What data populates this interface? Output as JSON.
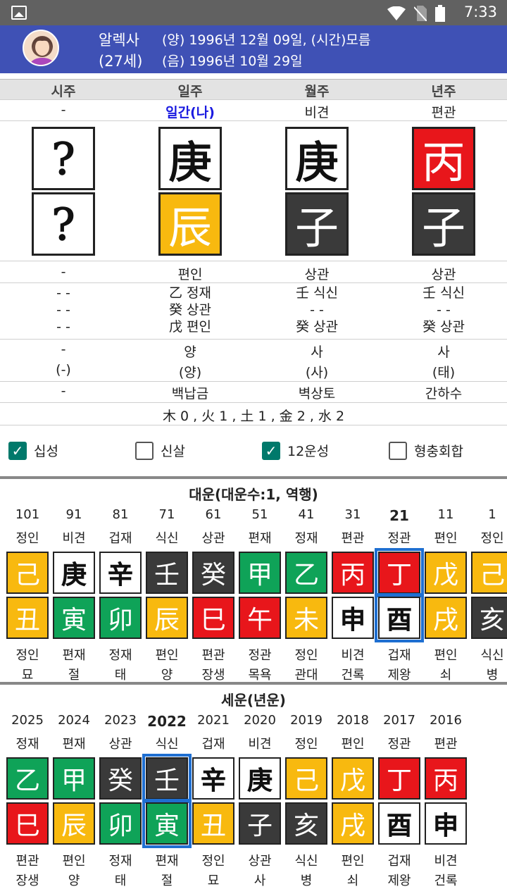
{
  "status": {
    "time": "7:33"
  },
  "profile": {
    "name": "알렉사",
    "age": "(27세)",
    "solar": "(양) 1996년 12월 09일, (시간)모름",
    "lunar": "(음) 1996년 10월 29일"
  },
  "pillars": {
    "headers": [
      "시주",
      "일주",
      "월주",
      "년주"
    ],
    "roles": [
      "-",
      "일간(나)",
      "비견",
      "편관"
    ],
    "stems": [
      {
        "char": "?",
        "color": "white"
      },
      {
        "char": "庚",
        "color": "white"
      },
      {
        "char": "庚",
        "color": "white"
      },
      {
        "char": "丙",
        "color": "red"
      }
    ],
    "branches": [
      {
        "char": "?",
        "color": "white"
      },
      {
        "char": "辰",
        "color": "yellow"
      },
      {
        "char": "子",
        "color": "dark"
      },
      {
        "char": "子",
        "color": "dark"
      }
    ],
    "branch_roles": [
      "-",
      "편인",
      "상관",
      "상관"
    ],
    "hidden": [
      [
        "- -",
        "- -",
        "- -"
      ],
      [
        "乙 정재",
        "癸 상관",
        "戊 편인"
      ],
      [
        "壬 식신",
        "- -",
        "癸 상관"
      ],
      [
        "壬 식신",
        "- -",
        "癸 상관"
      ]
    ],
    "stage": [
      "-",
      "양",
      "사",
      "사"
    ],
    "stage2": [
      "(-)",
      "(양)",
      "(사)",
      "(태)"
    ],
    "napeum": [
      "-",
      "백납금",
      "벽상토",
      "간하수"
    ],
    "elements": "木 0 , 火 1 , 土 1 , 金 2 , 水 2"
  },
  "options": [
    {
      "label": "십성",
      "checked": true
    },
    {
      "label": "신살",
      "checked": false
    },
    {
      "label": "12운성",
      "checked": true
    },
    {
      "label": "형충회합",
      "checked": false
    }
  ],
  "daeun": {
    "title": "대운(대운수:1, 역행)",
    "items": [
      {
        "age": "101",
        "role": "정인",
        "stem": "己",
        "sc": "yellow",
        "branch": "丑",
        "bc": "yellow",
        "brole": "정인",
        "stage": "묘"
      },
      {
        "age": "91",
        "role": "비견",
        "stem": "庚",
        "sc": "white",
        "branch": "寅",
        "bc": "green",
        "brole": "편재",
        "stage": "절"
      },
      {
        "age": "81",
        "role": "겁재",
        "stem": "辛",
        "sc": "white",
        "branch": "卯",
        "bc": "green",
        "brole": "정재",
        "stage": "태"
      },
      {
        "age": "71",
        "role": "식신",
        "stem": "壬",
        "sc": "dark",
        "branch": "辰",
        "bc": "yellow",
        "brole": "편인",
        "stage": "양"
      },
      {
        "age": "61",
        "role": "상관",
        "stem": "癸",
        "sc": "dark",
        "branch": "巳",
        "bc": "red",
        "brole": "편관",
        "stage": "장생"
      },
      {
        "age": "51",
        "role": "편재",
        "stem": "甲",
        "sc": "green",
        "branch": "午",
        "bc": "red",
        "brole": "정관",
        "stage": "목욕"
      },
      {
        "age": "41",
        "role": "정재",
        "stem": "乙",
        "sc": "green",
        "branch": "未",
        "bc": "yellow",
        "brole": "정인",
        "stage": "관대"
      },
      {
        "age": "31",
        "role": "편관",
        "stem": "丙",
        "sc": "red",
        "branch": "申",
        "bc": "white",
        "brole": "비견",
        "stage": "건록"
      },
      {
        "age": "21",
        "role": "정관",
        "stem": "丁",
        "sc": "red",
        "branch": "酉",
        "bc": "white",
        "brole": "겁재",
        "stage": "제왕",
        "selected": true
      },
      {
        "age": "11",
        "role": "편인",
        "stem": "戊",
        "sc": "yellow",
        "branch": "戌",
        "bc": "yellow",
        "brole": "편인",
        "stage": "쇠"
      },
      {
        "age": "1",
        "role": "정인",
        "stem": "己",
        "sc": "yellow",
        "branch": "亥",
        "bc": "dark",
        "brole": "식신",
        "stage": "병"
      }
    ]
  },
  "seun": {
    "title": "세운(년운)",
    "items": [
      {
        "year": "2025",
        "role": "정재",
        "stem": "乙",
        "sc": "green",
        "branch": "巳",
        "bc": "red",
        "brole": "편관",
        "stage": "장생"
      },
      {
        "year": "2024",
        "role": "편재",
        "stem": "甲",
        "sc": "green",
        "branch": "辰",
        "bc": "yellow",
        "brole": "편인",
        "stage": "양"
      },
      {
        "year": "2023",
        "role": "상관",
        "stem": "癸",
        "sc": "dark",
        "branch": "卯",
        "bc": "green",
        "brole": "정재",
        "stage": "태"
      },
      {
        "year": "2022",
        "role": "식신",
        "stem": "壬",
        "sc": "dark",
        "branch": "寅",
        "bc": "green",
        "brole": "편재",
        "stage": "절",
        "selected": true
      },
      {
        "year": "2021",
        "role": "겁재",
        "stem": "辛",
        "sc": "white",
        "branch": "丑",
        "bc": "yellow",
        "brole": "정인",
        "stage": "묘"
      },
      {
        "year": "2020",
        "role": "비견",
        "stem": "庚",
        "sc": "white",
        "branch": "子",
        "bc": "dark",
        "brole": "상관",
        "stage": "사"
      },
      {
        "year": "2019",
        "role": "정인",
        "stem": "己",
        "sc": "yellow",
        "branch": "亥",
        "bc": "dark",
        "brole": "식신",
        "stage": "병"
      },
      {
        "year": "2018",
        "role": "편인",
        "stem": "戊",
        "sc": "yellow",
        "branch": "戌",
        "bc": "yellow",
        "brole": "편인",
        "stage": "쇠"
      },
      {
        "year": "2017",
        "role": "정관",
        "stem": "丁",
        "sc": "red",
        "branch": "酉",
        "bc": "white",
        "brole": "겁재",
        "stage": "제왕"
      },
      {
        "year": "2016",
        "role": "편관",
        "stem": "丙",
        "sc": "red",
        "branch": "申",
        "bc": "white",
        "brole": "비견",
        "stage": "건록"
      }
    ]
  }
}
